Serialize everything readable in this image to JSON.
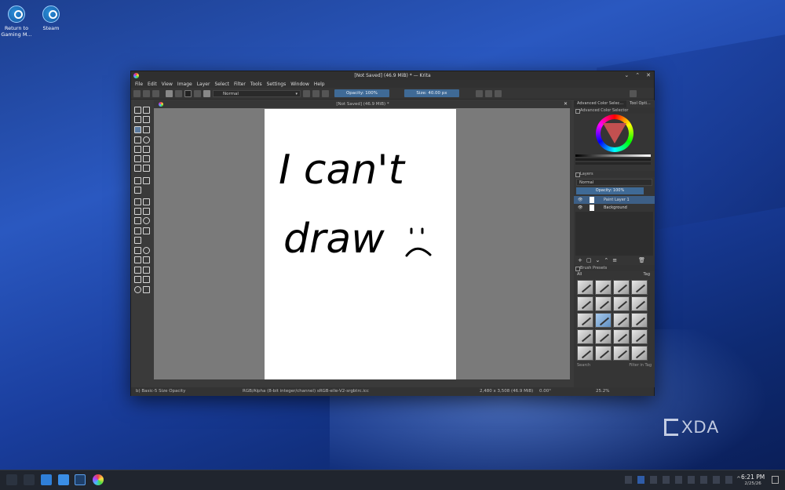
{
  "desktop": {
    "icons": [
      {
        "name": "return-to-gaming-mode",
        "label": "Return to\nGaming M..."
      },
      {
        "name": "steam",
        "label": "Steam"
      }
    ]
  },
  "window": {
    "title": "[Not Saved] (46.9 MiB) * — Krita",
    "menu": [
      "File",
      "Edit",
      "View",
      "Image",
      "Layer",
      "Select",
      "Filter",
      "Tools",
      "Settings",
      "Window",
      "Help"
    ],
    "toolbar": {
      "blend_mode": "Normal",
      "opacity": "Opacity: 100%",
      "size": "Size: 40.00 px"
    },
    "doc_tab": "[Not Saved]  (46.9 MiB) *",
    "canvas_text": [
      "I can't",
      "draw"
    ],
    "dock": {
      "tabs": [
        "Advanced Color Selec...",
        "Tool Opti..."
      ],
      "color_panel_title": "Advanced Color Selector",
      "layers_title": "Layers",
      "layers_blend": "Normal",
      "layers_opacity": "Opacity: 100%",
      "layers": [
        {
          "name": "Paint Layer 1",
          "selected": true
        },
        {
          "name": "Background",
          "selected": false
        }
      ],
      "brush_title": "Brush Presets",
      "brush_filter": "All",
      "brush_tag": "Tag",
      "brush_search": "Search",
      "filter_in_tag": "Filter in Tag"
    },
    "status": {
      "brush": "b) Basic-5 Size Opacity",
      "color_space": "RGB/Alpha (8-bit integer/channel)  sRGB-elle-V2-srgbtrc.icc",
      "dimensions": "2,480 x 3,508 (46.9 MiB)",
      "rotation": "0.00°",
      "zoom": "25.2%"
    }
  },
  "watermark": "XDA",
  "taskbar": {
    "time": "6:21 PM",
    "date": "2/25/26"
  }
}
